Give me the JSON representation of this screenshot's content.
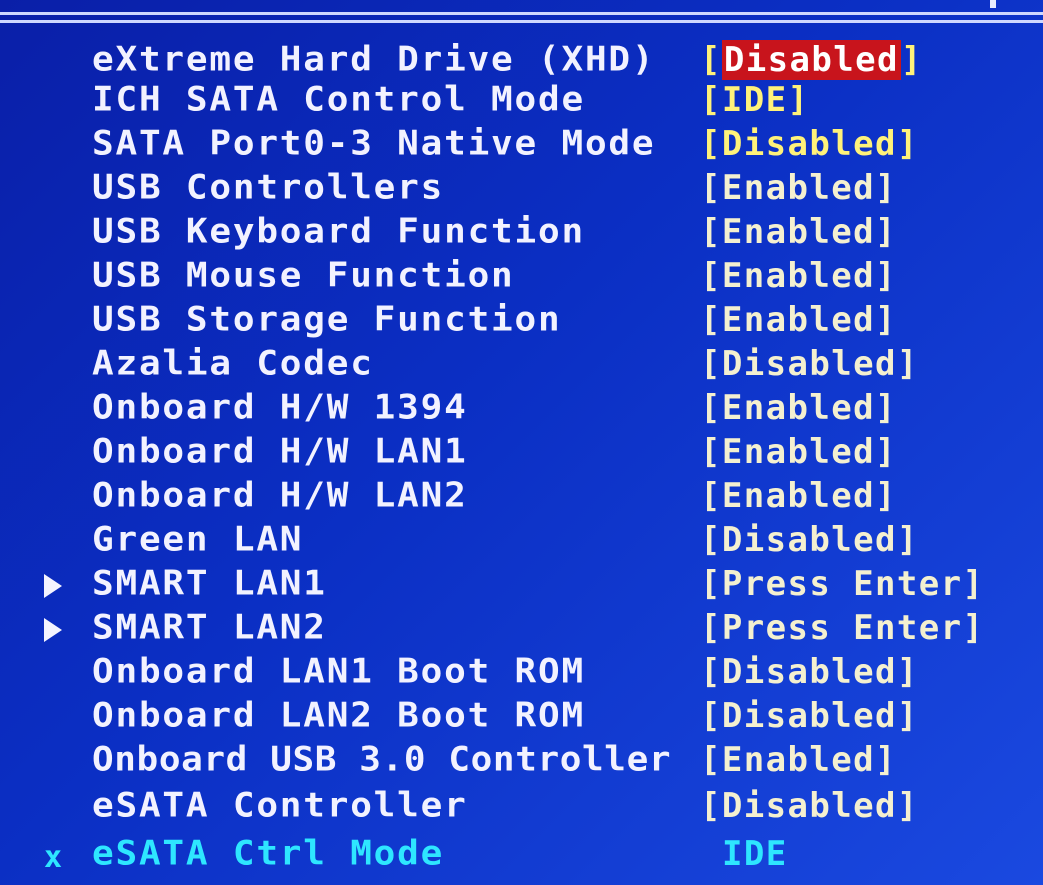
{
  "colors": {
    "background": "#0b2fc4",
    "label": "#f2f2ff",
    "value": "#fff27a",
    "highlight": "#c8141c",
    "disabled": "#2ee6ff"
  },
  "items": [
    {
      "label": "eXtreme Hard Drive (XHD)",
      "value": "Disabled",
      "bracket": true,
      "selected": true
    },
    {
      "label": "ICH SATA Control Mode",
      "value": "IDE",
      "bracket": true
    },
    {
      "label": "SATA Port0-3 Native Mode",
      "value": "Disabled",
      "bracket": true
    },
    {
      "label": "USB Controllers",
      "value": "Enabled",
      "bracket": true
    },
    {
      "label": "USB Keyboard Function",
      "value": "Enabled",
      "bracket": true
    },
    {
      "label": "USB Mouse Function",
      "value": "Enabled",
      "bracket": true
    },
    {
      "label": "USB Storage Function",
      "value": "Enabled",
      "bracket": true
    },
    {
      "label": "Azalia Codec",
      "value": "Disabled",
      "bracket": true
    },
    {
      "label": "Onboard H/W 1394",
      "value": "Enabled",
      "bracket": true
    },
    {
      "label": "Onboard H/W LAN1",
      "value": "Enabled",
      "bracket": true
    },
    {
      "label": "Onboard H/W LAN2",
      "value": "Enabled",
      "bracket": true
    },
    {
      "label": "Green LAN",
      "value": "Disabled",
      "bracket": true
    },
    {
      "label": "SMART LAN1",
      "value": "Press Enter",
      "bracket": true,
      "submenu": true,
      "submenu_icon": "triangle-right-icon"
    },
    {
      "label": "SMART LAN2",
      "value": "Press Enter",
      "bracket": true,
      "submenu": true,
      "submenu_icon": "triangle-right-icon"
    },
    {
      "label": "Onboard LAN1 Boot ROM",
      "value": "Disabled",
      "bracket": true
    },
    {
      "label": "Onboard LAN2 Boot ROM",
      "value": "Disabled",
      "bracket": true
    },
    {
      "label": "Onboard USB 3.0 Controller",
      "value": "Enabled",
      "bracket": true,
      "tight": true
    },
    {
      "label": "eSATA Controller",
      "value": "Disabled",
      "bracket": true
    },
    {
      "label": "eSATA Ctrl Mode",
      "value": "IDE",
      "bracket": false,
      "disabled": true,
      "marker": "x"
    }
  ]
}
